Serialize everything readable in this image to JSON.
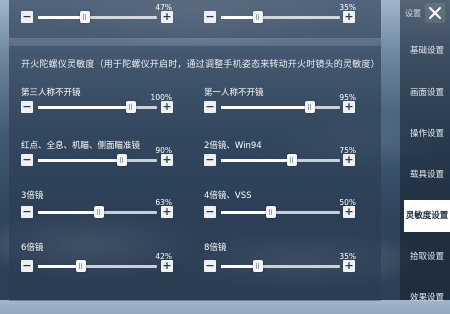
{
  "header": {
    "tab_label": "设置"
  },
  "top_sliders": [
    {
      "value": "47%",
      "percent": 47
    },
    {
      "value": "35%",
      "percent": 35
    }
  ],
  "section": {
    "title": "开火陀螺仪灵敏度（用于陀螺仪开启时，通过调整手机姿态来转动开火时镜头的灵敏度）"
  },
  "sliders": [
    {
      "label": "第三人称不开镜",
      "value": "100%",
      "percent": 100
    },
    {
      "label": "第一人称不开镜",
      "value": "95%",
      "percent": 95
    },
    {
      "label": "红点、全息、机瞄、侧面瞄准镜",
      "value": "90%",
      "percent": 90
    },
    {
      "label": "2倍镜、Win94",
      "value": "75%",
      "percent": 75
    },
    {
      "label": "3倍镜",
      "value": "63%",
      "percent": 63
    },
    {
      "label": "4倍镜、VSS",
      "value": "50%",
      "percent": 50
    },
    {
      "label": "6倍镜",
      "value": "42%",
      "percent": 42
    },
    {
      "label": "8倍镜",
      "value": "35%",
      "percent": 35
    }
  ],
  "buttons": {
    "minus": "−",
    "plus": "+"
  },
  "sidebar": {
    "items": [
      {
        "label": "基础设置",
        "active": false
      },
      {
        "label": "画面设置",
        "active": false
      },
      {
        "label": "操作设置",
        "active": false
      },
      {
        "label": "载具设置",
        "active": false
      },
      {
        "label": "灵敏度设置",
        "active": true
      },
      {
        "label": "拾取设置",
        "active": false
      },
      {
        "label": "效果设置",
        "active": false
      }
    ]
  }
}
